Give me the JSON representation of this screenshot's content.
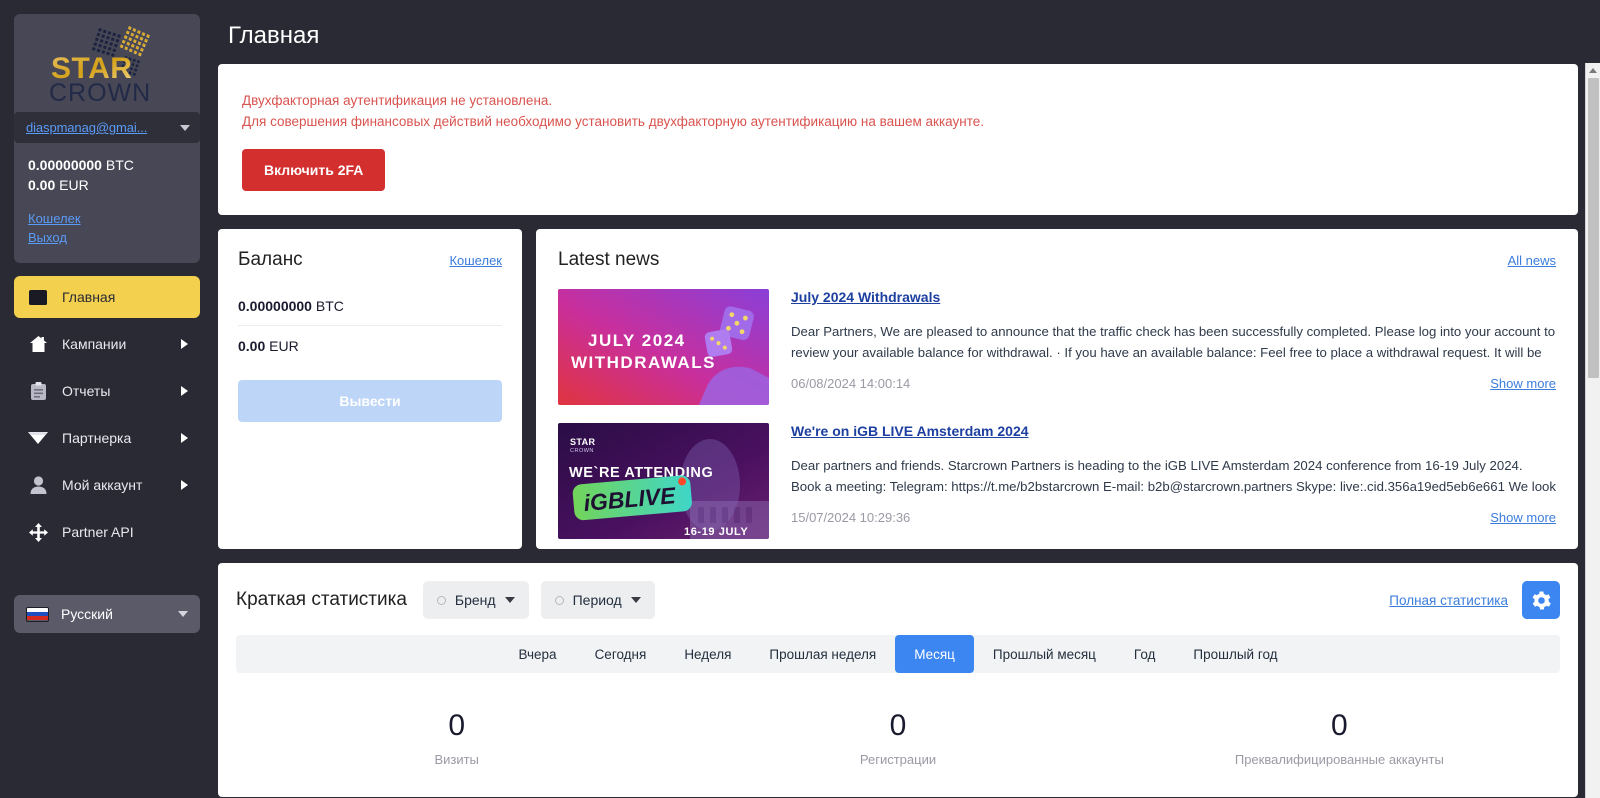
{
  "brand": {
    "name_top": "STAR",
    "name_bottom": "CROWN"
  },
  "colors": {
    "sidebar_bg": "#2a2a35",
    "sidebar_panel": "#474755",
    "active_nav": "#f3d04e",
    "accent_blue": "#3b86f0",
    "link_blue": "#3b7ddd",
    "alert_red": "#d9534f",
    "button_red": "#d32f2f",
    "withdraw_disabled": "#bdd5f7"
  },
  "sidebar": {
    "account": {
      "email": "diaspmanag@gmai...",
      "balances": [
        {
          "amount": "0.00000000",
          "currency": "BTC"
        },
        {
          "amount": "0.00",
          "currency": "EUR"
        }
      ],
      "links": [
        {
          "label": "Кошелек"
        },
        {
          "label": "Выход"
        }
      ]
    },
    "nav": [
      {
        "label": "Главная",
        "icon": "home-screen-icon",
        "active": true,
        "expandable": false
      },
      {
        "label": "Кампании",
        "icon": "house-icon",
        "active": false,
        "expandable": true
      },
      {
        "label": "Отчеты",
        "icon": "clipboard-icon",
        "active": false,
        "expandable": true
      },
      {
        "label": "Партнерка",
        "icon": "diamond-icon",
        "active": false,
        "expandable": true
      },
      {
        "label": "Мой аккаунт",
        "icon": "user-icon",
        "active": false,
        "expandable": true
      },
      {
        "label": "Partner API",
        "icon": "move-arrows-icon",
        "active": false,
        "expandable": false
      }
    ],
    "language": {
      "label": "Русский",
      "flag": "ru-flag-icon"
    }
  },
  "header": {
    "page_title": "Главная"
  },
  "alert": {
    "line1": "Двухфакторная аутентификация не установлена.",
    "line2": "Для совершения финансовых действий необходимо установить двухфакторную аутентификацию на вашем аккаунте.",
    "button_label": "Включить 2FA"
  },
  "balance_card": {
    "title": "Баланс",
    "wallet_link": "Кошелек",
    "rows": [
      {
        "amount": "0.00000000",
        "currency": "BTC"
      },
      {
        "amount": "0.00",
        "currency": "EUR"
      }
    ],
    "withdraw_label": "Вывести"
  },
  "news": {
    "title": "Latest news",
    "all_link": "All news",
    "show_more_label": "Show more",
    "items": [
      {
        "thumb_title_line1": "JULY 2024",
        "thumb_title_line2": "WITHDRAWALS",
        "headline": "July 2024 Withdrawals",
        "body": "Dear Partners,  We are pleased to announce that the traffic check has been successfully completed. Please log into your account to review your available balance for withdrawal.  · If you have an available balance: Feel free to place a withdrawal request. It will be processed ...",
        "date": "06/08/2024 14:00:14"
      },
      {
        "thumb_title_line1": "WE`RE ATTENDING",
        "thumb_title_line2": "iGBLIVE",
        "thumb_title_line3": "16-19 JULY",
        "headline": "We're on iGB LIVE Amsterdam 2024",
        "body": "Dear partners and friends.  Starcrown Partners is heading to the iGB LIVE Amsterdam 2024 conference from 16-19 July 2024.  Book a meeting:  Telegram: https://t.me/b2bstarcrown  E-mail: b2b@starcrown.partners  Skype: live:.cid.356a19ed5eb6e661  We look forward t...",
        "date": "15/07/2024 10:29:36"
      }
    ]
  },
  "stats": {
    "title": "Краткая статистика",
    "brand_filter": "Бренд",
    "period_filter": "Период",
    "full_stats_link": "Полная статистика",
    "settings_icon": "gear-icon",
    "tabs": [
      {
        "label": "Вчера",
        "active": false
      },
      {
        "label": "Сегодня",
        "active": false
      },
      {
        "label": "Неделя",
        "active": false
      },
      {
        "label": "Прошлая неделя",
        "active": false
      },
      {
        "label": "Месяц",
        "active": true
      },
      {
        "label": "Прошлый месяц",
        "active": false
      },
      {
        "label": "Год",
        "active": false
      },
      {
        "label": "Прошлый год",
        "active": false
      }
    ],
    "kpis": [
      {
        "value": "0",
        "label": "Визиты"
      },
      {
        "value": "0",
        "label": "Регистрации"
      },
      {
        "value": "0",
        "label": "Преквалифицированные аккаунты"
      }
    ]
  }
}
